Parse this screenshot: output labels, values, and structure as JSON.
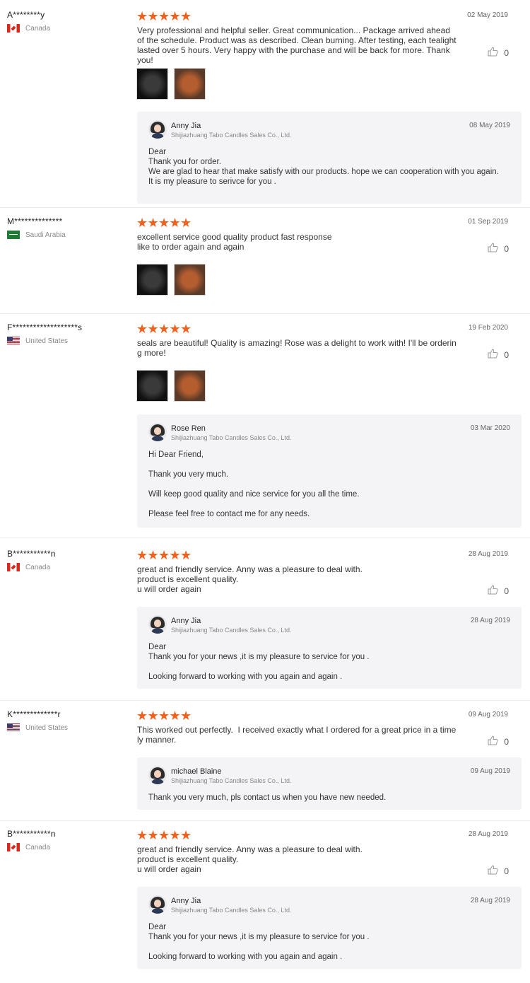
{
  "colors": {
    "star": "#f2601d",
    "reply_bg": "#f4f4f6"
  },
  "icons": {
    "star": "★",
    "like": "thumb-up-icon"
  },
  "reviews": [
    {
      "buyer": "A********y",
      "country": "Canada",
      "flag": "canada-flag-icon",
      "rating": 5,
      "date": "02 May 2019",
      "text": "Very professional and helpful seller. Great communication... Package arrived ahead of the schedule. Product was as described. Clean burning. After testing, each tealight lasted over 5 hours. Very happy with the purchase and will be back for more. Thank you!",
      "likes": "0",
      "photos": 2,
      "reply": {
        "name": "Anny Jia",
        "company": "Shijiazhuang Tabo Candles Sales Co., Ltd.",
        "date": "08 May 2019",
        "lines": [
          "Dear",
          "Thank you for order.",
          "We are glad to hear that make satisfy with our products. hope we can cooperation with you again.",
          "It is my pleasure to serivce for you ."
        ]
      }
    },
    {
      "buyer": "M**************",
      "country": "Saudi Arabia",
      "flag": "saudi-arabia-flag-icon",
      "rating": 5,
      "date": "01 Sep 2019",
      "text": "excellent service good quality product fast response\nlike to order again and again",
      "likes": "0",
      "photos": 2
    },
    {
      "buyer": "F*******************s",
      "country": "United States",
      "flag": "united-states-flag-icon",
      "rating": 5,
      "date": "19 Feb 2020",
      "text": "seals are beautiful! Quality is amazing! Rose was a delight to work with! I'll be ordering more!",
      "likes": "0",
      "photos": 2,
      "reply": {
        "name": "Rose Ren",
        "company": "Shijiazhuang Tabo Candles Sales Co., Ltd.",
        "date": "03 Mar 2020",
        "lines": [
          "Hi Dear Friend,",
          "",
          "Thank you very much.",
          "",
          "Will keep good quality and nice service for you all the time.",
          "",
          "Please feel free to contact me for any needs."
        ]
      }
    },
    {
      "buyer": "B***********n",
      "country": "Canada",
      "flag": "canada-flag-icon",
      "rating": 5,
      "date": "28 Aug 2019",
      "text": "great and friendly service. Anny was a pleasure to deal with.\nproduct is excellent quality.\nu will order again",
      "likes": "0",
      "photos": 0,
      "reply": {
        "name": "Anny Jia",
        "company": "Shijiazhuang Tabo Candles Sales Co., Ltd.",
        "date": "28 Aug 2019",
        "lines": [
          "Dear",
          "Thank you for your news ,it is my pleasure to service for you .",
          "",
          "Looking forward to working with you again and again ."
        ]
      }
    },
    {
      "buyer": "K*************r",
      "country": "United States",
      "flag": "united-states-flag-icon",
      "rating": 5,
      "date": "09 Aug 2019",
      "text": "This worked out perfectly.  I received exactly what I ordered for a great price in a timely manner.",
      "likes": "0",
      "photos": 0,
      "reply": {
        "name": "michael Blaine",
        "company": "Shijiazhuang Tabo Candles Sales Co., Ltd.",
        "date": "09 Aug 2019",
        "lines": [
          "Thank you very much, pls contact us when you have new needed."
        ]
      }
    },
    {
      "buyer": "B***********n",
      "country": "Canada",
      "flag": "canada-flag-icon",
      "rating": 5,
      "date": "28 Aug 2019",
      "text": "great and friendly service. Anny was a pleasure to deal with.\nproduct is excellent quality.\nu will order again",
      "likes": "0",
      "photos": 0,
      "reply": {
        "name": "Anny Jia",
        "company": "Shijiazhuang Tabo Candles Sales Co., Ltd.",
        "date": "28 Aug 2019",
        "lines": [
          "Dear",
          "Thank you for your news ,it is my pleasure to service for you .",
          "",
          "Looking forward to working with you again and again ."
        ]
      }
    }
  ]
}
